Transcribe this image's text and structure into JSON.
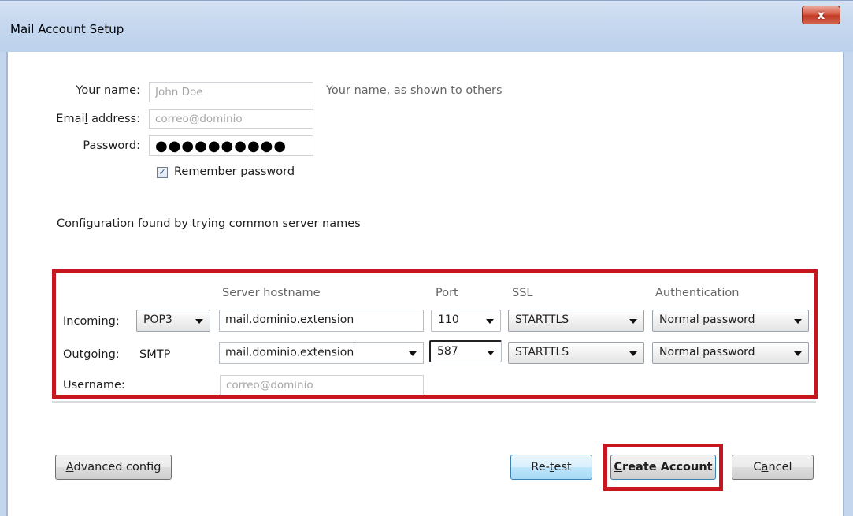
{
  "window": {
    "title": "Mail Account Setup",
    "close_glyph": "x"
  },
  "account": {
    "name_label": "Your name:",
    "name_placeholder": "John Doe",
    "name_hint": "Your name, as shown to others",
    "email_label": "Email address:",
    "email_value": "correo@dominio",
    "password_label": "Password:",
    "password_value": "●●●●●●●●●●",
    "remember_label": "Remember password",
    "remember_checked": true
  },
  "status": {
    "message": "Configuration found by trying common server names"
  },
  "server": {
    "headers": {
      "hostname": "Server hostname",
      "port": "Port",
      "ssl": "SSL",
      "auth": "Authentication"
    },
    "incoming": {
      "label": "Incoming:",
      "protocol": "POP3",
      "hostname": "mail.dominio.extension",
      "port": "110",
      "ssl": "STARTTLS",
      "auth": "Normal password"
    },
    "outgoing": {
      "label": "Outgoing:",
      "protocol": "SMTP",
      "hostname": "mail.dominio.extension",
      "port": "587",
      "ssl": "STARTTLS",
      "auth": "Normal password"
    },
    "username": {
      "label": "Username:",
      "value": "correo@dominio"
    }
  },
  "buttons": {
    "advanced": "Advanced config",
    "retest": "Re-test",
    "create": "Create Account",
    "cancel": "Cancel"
  },
  "colors": {
    "highlight": "#c8161f",
    "titlebar": "#c6d8ef"
  }
}
